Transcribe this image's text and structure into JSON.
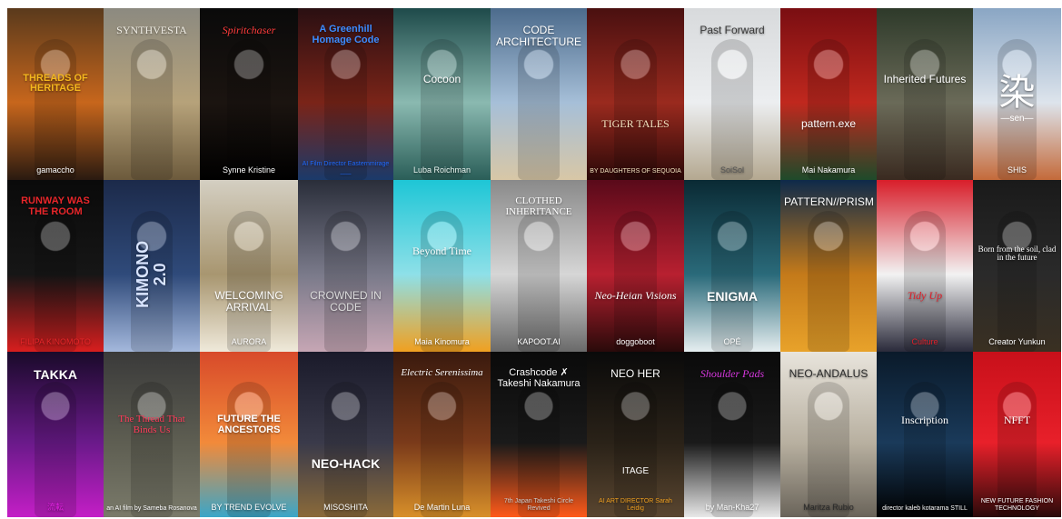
{
  "gallery": {
    "rows": [
      [
        {
          "id": "r1c1",
          "title": "THREADS OF HERITAGE",
          "credit": "gamaccho",
          "colors": [
            "#5a3a1c",
            "#c7661c",
            "#2a1a10"
          ],
          "title_color": "#f5b81e",
          "credit_color": "#ffffff",
          "title_pos": "mid",
          "style": "bold"
        },
        {
          "id": "r1c2",
          "title": "SYNTHVESTA",
          "credit": "",
          "colors": [
            "#8c8a80",
            "#b6a27a",
            "#6c5a3c"
          ],
          "title_color": "#f2efe6",
          "credit_color": "#ffffff",
          "title_pos": "top",
          "style": "serif"
        },
        {
          "id": "r1c3",
          "title": "Spiritchaser",
          "credit": "Synne Kristine",
          "colors": [
            "#0a0a0a",
            "#1b1410",
            "#000000"
          ],
          "title_color": "#ff3b3b",
          "credit_color": "#ffffff",
          "title_pos": "top",
          "style": "script"
        },
        {
          "id": "r1c4",
          "title": "A Greenhill Homage Code",
          "credit": "AI Film Director Easternmirage ___",
          "colors": [
            "#2a0f12",
            "#7a2418",
            "#1b3a6a"
          ],
          "title_color": "#3c8cff",
          "credit_color": "#1f6bff",
          "title_pos": "top",
          "style": "bold"
        },
        {
          "id": "r1c5",
          "title": "Cocoon",
          "credit": "Luba Roichman",
          "colors": [
            "#1e4a4a",
            "#8ab9b0",
            "#2a5e58"
          ],
          "title_color": "#ffffff",
          "credit_color": "#eaf6f2",
          "title_pos": "mid",
          "style": "light"
        },
        {
          "id": "r1c6",
          "title": "CODE ARCHITECTURE",
          "credit": "",
          "colors": [
            "#4c6b8c",
            "#a6bfd8",
            "#d8c7a6"
          ],
          "title_color": "#ffffff",
          "credit_color": "#ffffff",
          "title_pos": "top",
          "style": "light"
        },
        {
          "id": "r1c7",
          "title": "TIGER TALES",
          "credit": "BY DAUGHTERS OF SEQUOIA",
          "colors": [
            "#4a1010",
            "#9a2a1e",
            "#2a0808"
          ],
          "title_color": "#f3e3c0",
          "credit_color": "#f3e3c0",
          "title_pos": "bottom",
          "style": "serif"
        },
        {
          "id": "r1c8",
          "title": "Past Forward",
          "credit": "SoiSol",
          "colors": [
            "#d8dadc",
            "#eceef0",
            "#b4a890"
          ],
          "title_color": "#3a3a3a",
          "credit_color": "#555555",
          "title_pos": "top",
          "style": "light"
        },
        {
          "id": "r1c9",
          "title": "pattern.exe",
          "credit": "Mai Nakamura",
          "colors": [
            "#7a0e12",
            "#c0281e",
            "#1e4a2a"
          ],
          "title_color": "#ffffff",
          "credit_color": "#ffffff",
          "title_pos": "bottom",
          "style": "light"
        },
        {
          "id": "r1c10",
          "title": "Inherited Futures",
          "credit": "",
          "colors": [
            "#2e3a2a",
            "#6a6a58",
            "#3a2a20"
          ],
          "title_color": "#ffffff",
          "credit_color": "#ffffff",
          "title_pos": "mid",
          "style": "light"
        },
        {
          "id": "r1c11",
          "title": "染",
          "credit": "SHIS",
          "colors": [
            "#8aa6c4",
            "#dde4ec",
            "#c46a3a"
          ],
          "title_color": "#ffffff",
          "credit_color": "#ffffff",
          "title_pos": "mid",
          "style": "kanji",
          "sub": "—sen—"
        }
      ],
      [
        {
          "id": "r2c1",
          "title": "RUNWAY WAS THE ROOM",
          "credit": "FILIPA KINOMOTO",
          "colors": [
            "#0a0a0a",
            "#161616",
            "#d81e1e"
          ],
          "title_color": "#e8262a",
          "credit_color": "#e8262a",
          "title_pos": "top",
          "style": "bold"
        },
        {
          "id": "r2c2",
          "title": "KIMONO 2.0",
          "credit": "",
          "colors": [
            "#1c2a4a",
            "#2f4a7a",
            "#a4b8dc"
          ],
          "title_color": "#d8e4ff",
          "credit_color": "#ffffff",
          "title_pos": "vertical",
          "style": "bold"
        },
        {
          "id": "r2c3",
          "title": "WELCOMING ARRIVAL",
          "credit": "AURORA",
          "colors": [
            "#d4cfc2",
            "#a89670",
            "#efe9da"
          ],
          "title_color": "#ffffff",
          "credit_color": "#ffffff",
          "title_pos": "bottom",
          "style": "light"
        },
        {
          "id": "r2c4",
          "title": "CROWNED IN CODE",
          "credit": "",
          "colors": [
            "#2a2e3a",
            "#7a7a8a",
            "#c6a6b4"
          ],
          "title_color": "#dcdcdc",
          "credit_color": "#ffffff",
          "title_pos": "bottom",
          "style": "light"
        },
        {
          "id": "r2c5",
          "title": "Beyond Time",
          "credit": "Maia Kinomura",
          "colors": [
            "#1ec6d6",
            "#8ee0e8",
            "#f0a020"
          ],
          "title_color": "#ffffff",
          "credit_color": "#ffffff",
          "title_pos": "mid",
          "style": "serif"
        },
        {
          "id": "r2c6",
          "title": "CLOTHED INHERITANCE",
          "credit": "KAPOOT.AI",
          "colors": [
            "#8a8a8a",
            "#d6d6d6",
            "#6a6a6a"
          ],
          "title_color": "#ffffff",
          "credit_color": "#ffffff",
          "title_pos": "top",
          "style": "serif"
        },
        {
          "id": "r2c7",
          "title": "Neo-Heian Visions",
          "credit": "doggoboot",
          "colors": [
            "#5a0a1a",
            "#b82030",
            "#2a0a0a"
          ],
          "title_color": "#ffffff",
          "credit_color": "#ffffff",
          "title_pos": "bottom",
          "style": "script"
        },
        {
          "id": "r2c8",
          "title": "ENIGMA",
          "credit": "OPÉ",
          "colors": [
            "#0a2a34",
            "#2a6a7a",
            "#e6eef0"
          ],
          "title_color": "#ffffff",
          "credit_color": "#ffffff",
          "title_pos": "bottom",
          "style": "bold"
        },
        {
          "id": "r2c9",
          "title": "PATTERN//PRISM",
          "credit": "",
          "colors": [
            "#0e2a4a",
            "#c47a1a",
            "#e8a22a"
          ],
          "title_color": "#ffffff",
          "credit_color": "#ffffff",
          "title_pos": "top",
          "style": "light"
        },
        {
          "id": "r2c10",
          "title": "Tidy Up",
          "credit": "Culture",
          "colors": [
            "#d81e2a",
            "#f2f2f2",
            "#2a2a3a"
          ],
          "title_color": "#e0202a",
          "credit_color": "#e0202a",
          "title_pos": "bottom",
          "style": "script"
        },
        {
          "id": "r2c11",
          "title": "Born from the soil, clad in the future",
          "credit": "Creator Yunkun",
          "colors": [
            "#1a1a1a",
            "#2a2a2a",
            "#3a3022"
          ],
          "title_color": "#ffffff",
          "credit_color": "#ffffff",
          "title_pos": "mid",
          "style": "serif"
        }
      ],
      [
        {
          "id": "r3c1",
          "title": "TAKKA",
          "credit": "流転",
          "colors": [
            "#1a0a2a",
            "#6a1a8a",
            "#c41ec6"
          ],
          "title_color": "#ffffff",
          "credit_color": "#e020e0",
          "title_pos": "top",
          "style": "bold"
        },
        {
          "id": "r3c2",
          "title": "The Thread That Binds Us",
          "credit": "an AI film by Sameba Rosanova",
          "colors": [
            "#3a3a3a",
            "#5e5e52",
            "#7a7a6a"
          ],
          "title_color": "#ff3b5a",
          "credit_color": "#ffffff",
          "title_pos": "mid",
          "style": "serif"
        },
        {
          "id": "r3c3",
          "title": "FUTURE THE ANCESTORS",
          "credit": "BY TREND EVOLVE",
          "colors": [
            "#d84a2a",
            "#f28a3a",
            "#3aa6c8"
          ],
          "title_color": "#ffffff",
          "credit_color": "#ffffff",
          "title_pos": "mid",
          "style": "bold"
        },
        {
          "id": "r3c4",
          "title": "NEO-HACK",
          "credit": "MISOSHITA",
          "colors": [
            "#1a1a2a",
            "#3a3a4a",
            "#8a6a3a"
          ],
          "title_color": "#ffffff",
          "credit_color": "#ffffff",
          "title_pos": "bottom",
          "style": "bold"
        },
        {
          "id": "r3c5",
          "title": "Electric Serenissima",
          "credit": "De Martin Luna",
          "colors": [
            "#3a1a0e",
            "#7a3a1a",
            "#d8902a"
          ],
          "title_color": "#ffffff",
          "credit_color": "#ffffff",
          "title_pos": "top",
          "style": "script"
        },
        {
          "id": "r3c6",
          "title": "Crashcode ✗ Takeshi Nakamura",
          "credit": "7th Japan Takeshi Circle Revived",
          "colors": [
            "#0a0a0a",
            "#1a1a1a",
            "#ff5a1a"
          ],
          "title_color": "#ffffff",
          "credit_color": "#cccccc",
          "title_pos": "top",
          "style": "light"
        },
        {
          "id": "r3c7",
          "title": "NEO HER",
          "credit": "AI ART DIRECTOR Sarah Leidig",
          "colors": [
            "#0a0a0a",
            "#2a2218",
            "#5a4630"
          ],
          "title_color": "#ffffff",
          "credit_color": "#f0a020",
          "title_pos": "top",
          "style": "light",
          "sub": "ITAGE"
        },
        {
          "id": "r3c8",
          "title": "Shoulder Pads",
          "credit": "by Man-Kha27",
          "colors": [
            "#0a0a0a",
            "#1a1a1a",
            "#e8e8e8"
          ],
          "title_color": "#d838e0",
          "credit_color": "#ffffff",
          "title_pos": "top",
          "style": "script"
        },
        {
          "id": "r3c9",
          "title": "NEO-ANDALUS",
          "credit": "Maritza Rubio",
          "colors": [
            "#e8e4dc",
            "#b8b0a0",
            "#6a645a"
          ],
          "title_color": "#2a2a2a",
          "credit_color": "#2a2a2a",
          "title_pos": "top",
          "style": "light"
        },
        {
          "id": "r3c10",
          "title": "Inscription",
          "credit": "director kaleb kotarama STILL",
          "colors": [
            "#0a1a2a",
            "#1a3a5a",
            "#000000"
          ],
          "title_color": "#ffffff",
          "credit_color": "#ffffff",
          "title_pos": "mid",
          "style": "serif"
        },
        {
          "id": "r3c11",
          "title": "NFFT",
          "credit": "NEW FUTURE FASHION TECHNOLOGY",
          "colors": [
            "#c8101a",
            "#e8202a",
            "#2a0a0a"
          ],
          "title_color": "#ffffff",
          "credit_color": "#ffffff",
          "title_pos": "mid",
          "style": "serif"
        }
      ]
    ]
  }
}
